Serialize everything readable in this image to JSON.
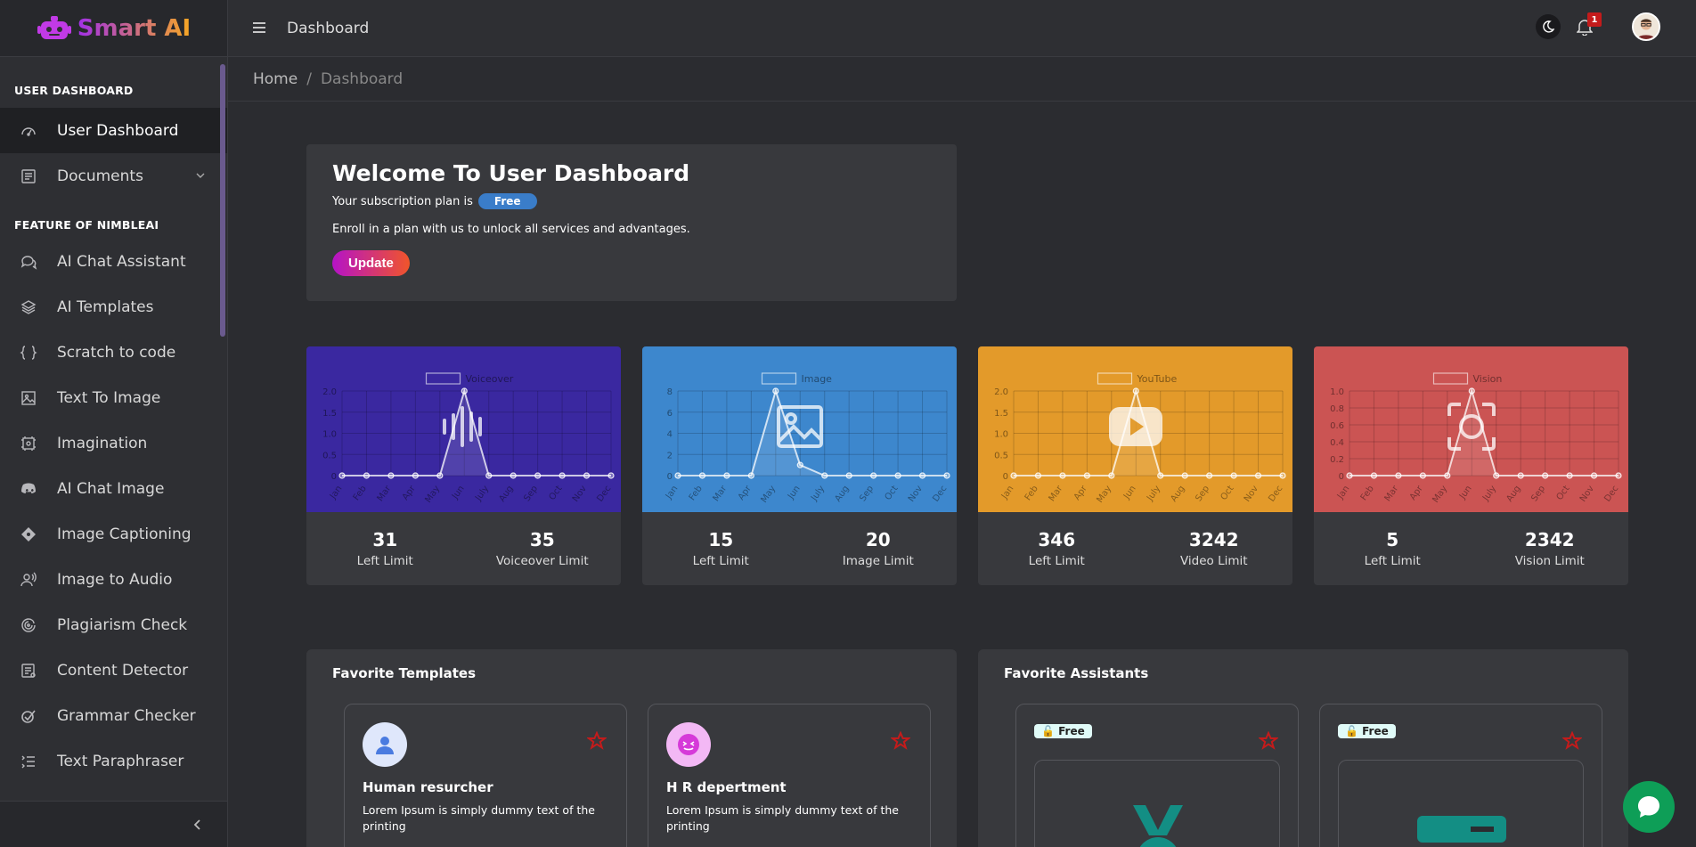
{
  "app": {
    "name": "Smart AI"
  },
  "topbar": {
    "title": "Dashboard",
    "notification_count": "1"
  },
  "breadcrumb": {
    "home": "Home",
    "separator": "/",
    "current": "Dashboard"
  },
  "sidebar": {
    "section1": "USER DASHBOARD",
    "section2": "FEATURE OF NIMBLEAI",
    "items": [
      {
        "label": "User Dashboard",
        "icon": "gauge-icon"
      },
      {
        "label": "Documents",
        "icon": "document-icon"
      },
      {
        "label": "AI Chat Assistant",
        "icon": "chat-icon"
      },
      {
        "label": "AI Templates",
        "icon": "layers-icon"
      },
      {
        "label": "Scratch to code",
        "icon": "code-icon"
      },
      {
        "label": "Text To Image",
        "icon": "image-icon"
      },
      {
        "label": "Imagination",
        "icon": "frame-icon"
      },
      {
        "label": "AI Chat Image",
        "icon": "discord-icon"
      },
      {
        "label": "Image Captioning",
        "icon": "diamond-icon"
      },
      {
        "label": "Image to Audio",
        "icon": "voice-icon"
      },
      {
        "label": "Plagiarism Check",
        "icon": "swirl-icon"
      },
      {
        "label": "Content Detector",
        "icon": "detector-icon"
      },
      {
        "label": "Grammar Checker",
        "icon": "check-circle-icon"
      },
      {
        "label": "Text Paraphraser",
        "icon": "list-icon"
      }
    ]
  },
  "welcome": {
    "title": "Welcome To User Dashboard",
    "plan_prefix": "Your subscription plan is",
    "plan": "Free",
    "enroll": "Enroll in a plan with us to unlock all services and advantages.",
    "update_label": "Update"
  },
  "colors": {
    "voiceover": "#3a28a0",
    "image": "#3d87cd",
    "youtube": "#e39a2a",
    "vision": "#cb5453"
  },
  "chart_data": [
    {
      "type": "line",
      "series": [
        {
          "name": "Voiceover",
          "values": [
            0,
            0,
            0,
            0,
            0,
            2,
            0,
            0,
            0,
            0,
            0,
            0
          ]
        }
      ],
      "categories": [
        "Jan",
        "Feb",
        "Mar",
        "Apr",
        "May",
        "Jun",
        "July",
        "Aug",
        "Sep",
        "Oct",
        "Nov",
        "Dec"
      ],
      "yticks": [
        "2.0",
        "1.5",
        "1.0",
        "0.5",
        "0"
      ],
      "ylim": [
        0,
        2
      ]
    },
    {
      "type": "line",
      "series": [
        {
          "name": "Image",
          "values": [
            0,
            0,
            0,
            0,
            8,
            1,
            0,
            0,
            0,
            0,
            0,
            0
          ]
        }
      ],
      "categories": [
        "Jan",
        "Feb",
        "Mar",
        "Apr",
        "May",
        "Jun",
        "July",
        "Aug",
        "Sep",
        "Oct",
        "Nov",
        "Dec"
      ],
      "yticks": [
        "8",
        "6",
        "4",
        "2",
        "0"
      ],
      "ylim": [
        0,
        8
      ]
    },
    {
      "type": "line",
      "series": [
        {
          "name": "YouTube",
          "values": [
            0,
            0,
            0,
            0,
            0,
            2,
            0,
            0,
            0,
            0,
            0,
            0
          ]
        }
      ],
      "categories": [
        "Jan",
        "Feb",
        "Mar",
        "Apr",
        "May",
        "Jun",
        "July",
        "Aug",
        "Sep",
        "Oct",
        "Nov",
        "Dec"
      ],
      "yticks": [
        "2.0",
        "1.5",
        "1.0",
        "0.5",
        "0"
      ],
      "ylim": [
        0,
        2
      ]
    },
    {
      "type": "line",
      "series": [
        {
          "name": "Vision",
          "values": [
            0,
            0,
            0,
            0,
            0,
            1,
            0,
            0,
            0,
            0,
            0,
            0
          ]
        }
      ],
      "categories": [
        "Jan",
        "Feb",
        "Mar",
        "Apr",
        "May",
        "Jun",
        "July",
        "Aug",
        "Sep",
        "Oct",
        "Nov",
        "Dec"
      ],
      "yticks": [
        "1.0",
        "0.8",
        "0.6",
        "0.4",
        "0.2",
        "0"
      ],
      "ylim": [
        0,
        1
      ]
    }
  ],
  "cards": [
    {
      "left_value": "31",
      "left_label": "Left Limit",
      "right_value": "35",
      "right_label": "Voiceover Limit"
    },
    {
      "left_value": "15",
      "left_label": "Left Limit",
      "right_value": "20",
      "right_label": "Image Limit"
    },
    {
      "left_value": "346",
      "left_label": "Left Limit",
      "right_value": "3242",
      "right_label": "Video Limit"
    },
    {
      "left_value": "5",
      "left_label": "Left Limit",
      "right_value": "2342",
      "right_label": "Vision Limit"
    }
  ],
  "favorite_templates": {
    "title": "Favorite Templates",
    "items": [
      {
        "title": "Human resurcher",
        "desc": "Lorem Ipsum is simply dummy text of the printing",
        "avatar_color": "#dfe7fb"
      },
      {
        "title": "H R depertment",
        "desc": "Lorem Ipsum is simply dummy text of the printing",
        "avatar_color": "#f3b8f5"
      }
    ]
  },
  "favorite_assistants": {
    "title": "Favorite Assistants",
    "items": [
      {
        "badge": "Free"
      },
      {
        "badge": "Free"
      }
    ]
  }
}
